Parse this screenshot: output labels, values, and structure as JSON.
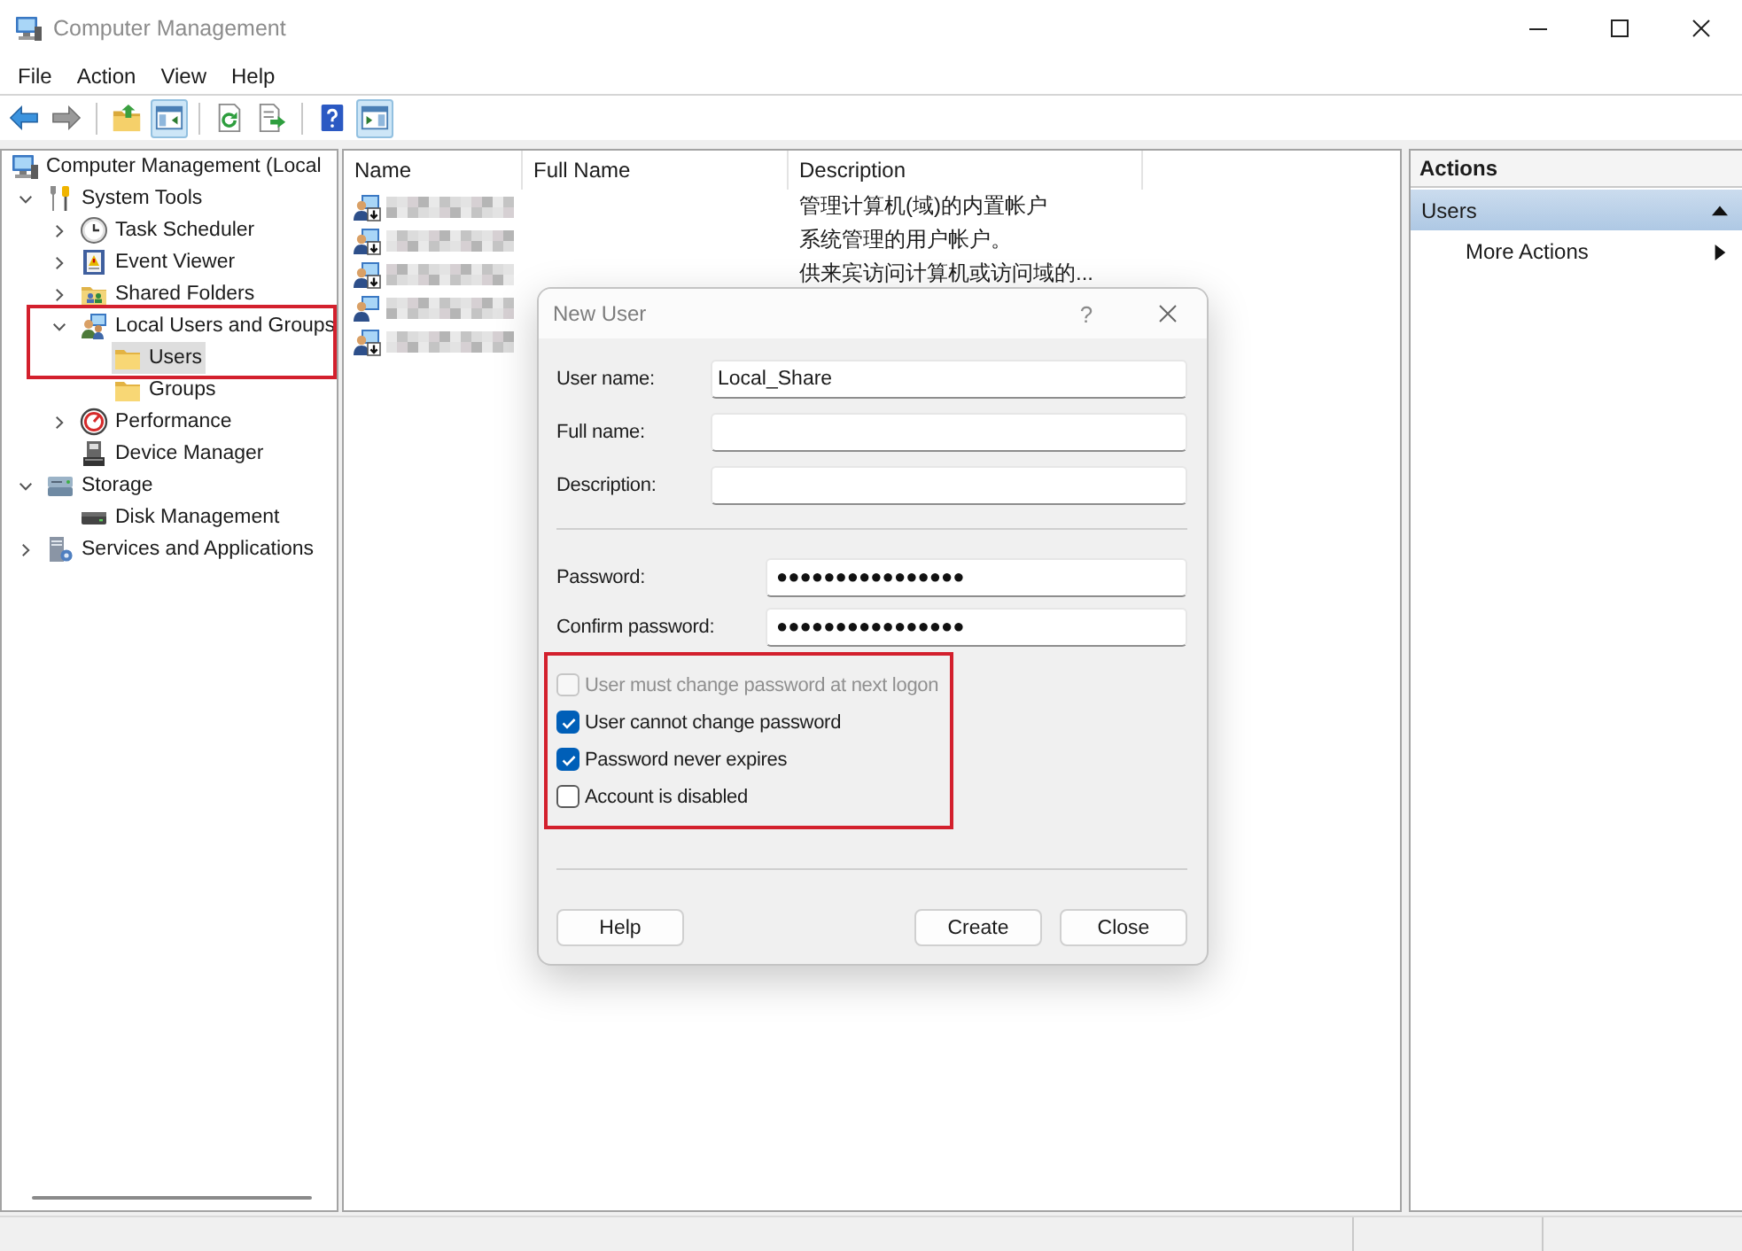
{
  "window": {
    "title": "Computer Management"
  },
  "menu": [
    "File",
    "Action",
    "View",
    "Help"
  ],
  "toolbar": [
    [
      {
        "kind": "back",
        "disabled": false,
        "pressed": false
      },
      {
        "kind": "forward",
        "disabled": true,
        "pressed": false
      }
    ],
    [
      {
        "kind": "up",
        "disabled": false,
        "pressed": false
      },
      {
        "kind": "console_tree",
        "disabled": false,
        "pressed": true
      }
    ],
    [
      {
        "kind": "refresh",
        "disabled": false,
        "pressed": false
      },
      {
        "kind": "export",
        "disabled": false,
        "pressed": false
      }
    ],
    [
      {
        "kind": "help",
        "disabled": false,
        "pressed": false
      },
      {
        "kind": "action_pane",
        "disabled": false,
        "pressed": true
      }
    ]
  ],
  "tree": [
    {
      "label": "Computer Management (Local",
      "kind": "computer",
      "expandable": false,
      "selected": false,
      "highlighted": false,
      "children": [
        {
          "label": "System Tools",
          "kind": "tools",
          "expandable": true,
          "expanded": true,
          "selected": false,
          "highlighted": false,
          "children": [
            {
              "label": "Task Scheduler",
              "kind": "clock",
              "expandable": true,
              "expanded": false,
              "selected": false,
              "highlighted": false
            },
            {
              "label": "Event Viewer",
              "kind": "log",
              "expandable": true,
              "expanded": false,
              "selected": false,
              "highlighted": false
            },
            {
              "label": "Shared Folders",
              "kind": "share",
              "expandable": true,
              "expanded": false,
              "selected": false,
              "highlighted": false
            },
            {
              "label": "Local Users and Groups",
              "kind": "users",
              "expandable": true,
              "expanded": true,
              "selected": false,
              "highlighted": true,
              "children": [
                {
                  "label": "Users",
                  "kind": "folder",
                  "expandable": false,
                  "selected": true,
                  "highlighted": false
                },
                {
                  "label": "Groups",
                  "kind": "folder",
                  "expandable": false,
                  "selected": false,
                  "highlighted": false
                }
              ]
            },
            {
              "label": "Performance",
              "kind": "performance",
              "expandable": true,
              "expanded": false,
              "selected": false,
              "highlighted": false
            },
            {
              "label": "Device Manager",
              "kind": "device",
              "expandable": false,
              "selected": false,
              "highlighted": false
            }
          ]
        },
        {
          "label": "Storage",
          "kind": "storage",
          "expandable": true,
          "expanded": true,
          "selected": false,
          "highlighted": false,
          "children": [
            {
              "label": "Disk Management",
              "kind": "disk",
              "expandable": false,
              "selected": false,
              "highlighted": false
            }
          ]
        },
        {
          "label": "Services and Applications",
          "kind": "services",
          "expandable": true,
          "expanded": false,
          "selected": false,
          "highlighted": false
        }
      ]
    }
  ],
  "list": {
    "columns": [
      "Name",
      "Full Name",
      "Description"
    ],
    "rows": [
      {
        "disabled": true,
        "description": "管理计算机(域)的内置帐户"
      },
      {
        "disabled": true,
        "description": "系统管理的用户帐户。"
      },
      {
        "disabled": true,
        "description": "供来宾访问计算机或访问域的..."
      },
      {
        "disabled": false
      },
      {
        "disabled": true
      }
    ]
  },
  "actions": {
    "title": "Actions",
    "sections": [
      {
        "title": "Users",
        "expanded": true,
        "items": [
          {
            "label": "More Actions",
            "submenu": true
          }
        ]
      }
    ]
  },
  "dialog": {
    "title": "New User",
    "help_button": "?",
    "field_groups": [
      [
        {
          "kind": "text",
          "label": "User name:",
          "value": "Local_Share"
        },
        {
          "kind": "text",
          "label": "Full name:"
        },
        {
          "kind": "text",
          "label": "Description:"
        }
      ],
      [
        {
          "kind": "password",
          "label": "Password:",
          "value": "●●●●●●●●●●●●●●●●"
        },
        {
          "kind": "password",
          "label": "Confirm password:",
          "value": "●●●●●●●●●●●●●●●●"
        }
      ]
    ],
    "options": {
      "highlighted": true,
      "items": [
        {
          "label": "User must change password at next logon",
          "checked": false,
          "disabled": true
        },
        {
          "label": "User cannot change password",
          "checked": true,
          "disabled": false
        },
        {
          "label": "Password never expires",
          "checked": true,
          "disabled": false
        },
        {
          "label": "Account is disabled",
          "checked": false,
          "disabled": false
        }
      ]
    },
    "buttons_left": [
      "Help"
    ],
    "buttons_right": [
      "Create",
      "Close"
    ]
  }
}
